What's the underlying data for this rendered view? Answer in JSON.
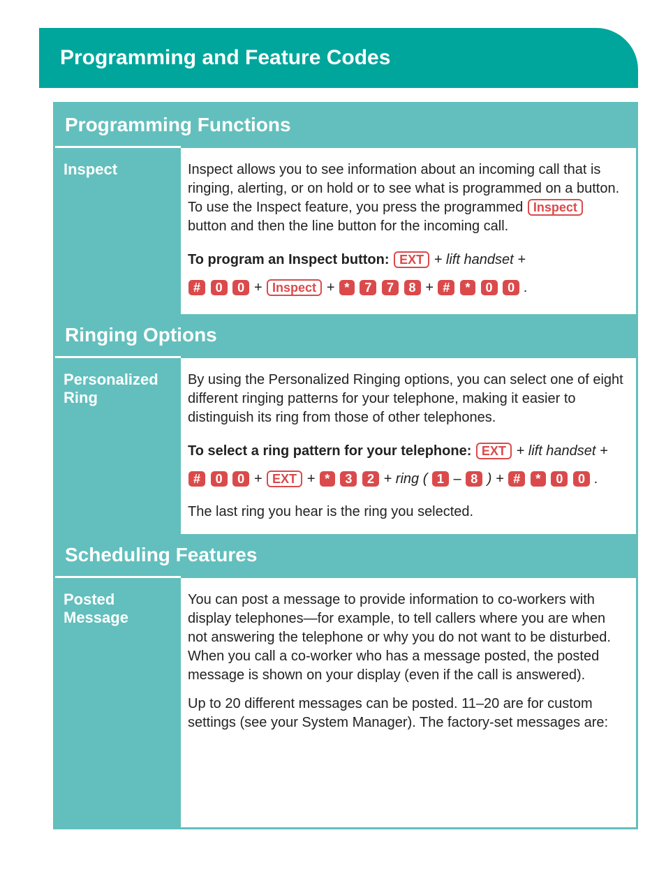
{
  "banner": "Programming and Feature Codes",
  "sections": {
    "prog_func": {
      "header": "Programming Functions",
      "inspect": {
        "label": "Inspect",
        "p1_a": "Inspect allows you to see information about an incoming call that is ringing, alerting, or on hold or to see what is programmed on a button. To use the Inspect feature, you press the programmed ",
        "p1_b": " button and then the line button for the incoming call.",
        "inline_inspect": "Inspect",
        "lead": "To program an Inspect button:",
        "ext": "EXT",
        "lift": "lift handset",
        "seq_inspect": "Inspect",
        "k": {
          "hash": "#",
          "zero": "0",
          "star": "*",
          "seven": "7",
          "eight": "8"
        }
      }
    },
    "ringing": {
      "header": "Ringing Options",
      "pers": {
        "line1": "Personalized",
        "line2": "Ring",
        "p1": "By using the Personalized Ringing options, you can select one of eight different ringing patterns for your telephone, making it easier to distinguish its ring from those of other telephones.",
        "lead": "To select a ring pattern for your telephone:",
        "ext": "EXT",
        "lift": "lift handset",
        "ring": "ring (",
        "p3": "The last ring you hear is the ring you selected.",
        "k": {
          "hash": "#",
          "zero": "0",
          "star": "*",
          "three": "3",
          "two": "2",
          "one": "1",
          "eight": "8",
          "dash": "–"
        }
      }
    },
    "sched": {
      "header": "Scheduling Features",
      "posted": {
        "line1": "Posted",
        "line2": "Message",
        "p1": "You can post a message to provide information to co-workers with display telephones—for example, to tell callers where you are when not answering the telephone or why you do not want to be disturbed. When you call a co-worker who has a message posted, the posted message is shown on your display (even if the call is answered).",
        "p2": "Up to 20 different messages can be posted. 11–20 are for custom settings (see your System Manager). The factory-set messages are:"
      }
    }
  }
}
